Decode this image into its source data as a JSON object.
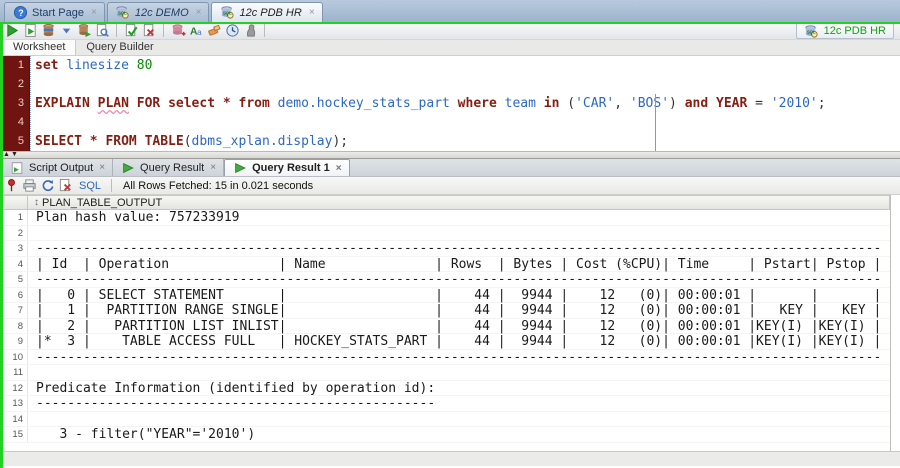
{
  "close_glyph": "×",
  "top_tabs": [
    {
      "label": "Start Page",
      "icon": "help-icon",
      "italic": false,
      "active": false
    },
    {
      "label": "12c DEMO",
      "icon": "connection-icon",
      "italic": true,
      "active": false
    },
    {
      "label": "12c PDB HR",
      "icon": "connection-icon",
      "italic": true,
      "active": true
    }
  ],
  "main_toolbar": {
    "icons": [
      "run-icon",
      "run-script-icon",
      "autotrace-icon",
      "dropdown-arrow-icon",
      "explain-plan-icon",
      "sql-tuning-icon",
      "sep",
      "commit-icon",
      "rollback-icon",
      "sep",
      "unshared-worksheet-icon",
      "case-toggle-icon",
      "clear-icon",
      "history-icon",
      "advisor-icon",
      "sep"
    ],
    "connection": {
      "label": "12c PDB HR",
      "icon": "connection-icon"
    }
  },
  "worksheet_tabs": [
    {
      "label": "Worksheet",
      "active": true
    },
    {
      "label": "Query Builder",
      "active": false
    }
  ],
  "editor": {
    "lines": [
      {
        "n": 1,
        "tokens": [
          {
            "c": "kw",
            "t": "set "
          },
          {
            "c": "id",
            "t": "linesize "
          },
          {
            "c": "num",
            "t": "80"
          }
        ]
      },
      {
        "n": 2,
        "tokens": []
      },
      {
        "n": 3,
        "tokens": [
          {
            "c": "kw",
            "t": "EXPLAIN "
          },
          {
            "c": "kw",
            "t": "PLAN",
            "w": true
          },
          {
            "c": "kw",
            "t": " FOR select * from "
          },
          {
            "c": "id",
            "t": "demo.hockey_stats_part"
          },
          {
            "c": "pl",
            "t": " "
          },
          {
            "c": "kw",
            "t": "where "
          },
          {
            "c": "id",
            "t": "team "
          },
          {
            "c": "kw",
            "t": "in "
          },
          {
            "c": "pl",
            "t": "("
          },
          {
            "c": "str",
            "t": "'CAR'"
          },
          {
            "c": "pl",
            "t": ", "
          },
          {
            "c": "str",
            "t": "'BOS'"
          },
          {
            "c": "pl",
            "t": ") "
          },
          {
            "c": "kw",
            "t": "and YEAR "
          },
          {
            "c": "pl",
            "t": "= "
          },
          {
            "c": "str",
            "t": "'2010'"
          },
          {
            "c": "pl",
            "t": ";"
          }
        ]
      },
      {
        "n": 4,
        "tokens": []
      },
      {
        "n": 5,
        "tokens": [
          {
            "c": "kw",
            "t": "SELECT * FROM TABLE"
          },
          {
            "c": "pl",
            "t": "("
          },
          {
            "c": "id",
            "t": "dbms_xplan.display"
          },
          {
            "c": "pl",
            "t": ");"
          }
        ]
      }
    ]
  },
  "splitter": {
    "up": "▲",
    "down": "▼"
  },
  "output_tabs": [
    {
      "label": "Script Output",
      "icon": "script-output-icon",
      "active": false
    },
    {
      "label": "Query Result",
      "icon": "query-result-icon",
      "active": false
    },
    {
      "label": "Query Result 1",
      "icon": "query-result-icon",
      "active": true
    }
  ],
  "result_toolbar": {
    "icons": [
      "pin-icon",
      "print-icon",
      "refresh-icon",
      "discard-icon"
    ],
    "sql_label": "SQL",
    "status": "All Rows Fetched: 15 in 0.021 seconds"
  },
  "grid": {
    "sort_glyph": "↕",
    "column": "PLAN_TABLE_OUTPUT",
    "rows": [
      "Plan hash value: 757233919",
      "",
      {
        "ch": "-",
        "count": 108
      },
      "| Id  | Operation              | Name              | Rows  | Bytes | Cost (%CPU)| Time     | Pstart| Pstop |",
      {
        "ch": "-",
        "count": 108
      },
      "|   0 | SELECT STATEMENT       |                   |    44 |  9944 |    12   (0)| 00:00:01 |       |       |",
      "|   1 |  PARTITION RANGE SINGLE|                   |    44 |  9944 |    12   (0)| 00:00:01 |   KEY |   KEY |",
      "|   2 |   PARTITION LIST INLIST|                   |    44 |  9944 |    12   (0)| 00:00:01 |KEY(I) |KEY(I) |",
      "|*  3 |    TABLE ACCESS FULL   | HOCKEY_STATS_PART |    44 |  9944 |    12   (0)| 00:00:01 |KEY(I) |KEY(I) |",
      {
        "ch": "-",
        "count": 108
      },
      "",
      "Predicate Information (identified by operation id):",
      {
        "ch": "-",
        "count": 51
      },
      "",
      "   3 - filter(\"YEAR\"='2010')"
    ]
  },
  "colors": {
    "annotation_green": "#22d222",
    "keyword": "#851e12",
    "identifier_blue": "#2c68c4",
    "number_green": "#0a8a0a",
    "connection_green": "#13a013"
  }
}
